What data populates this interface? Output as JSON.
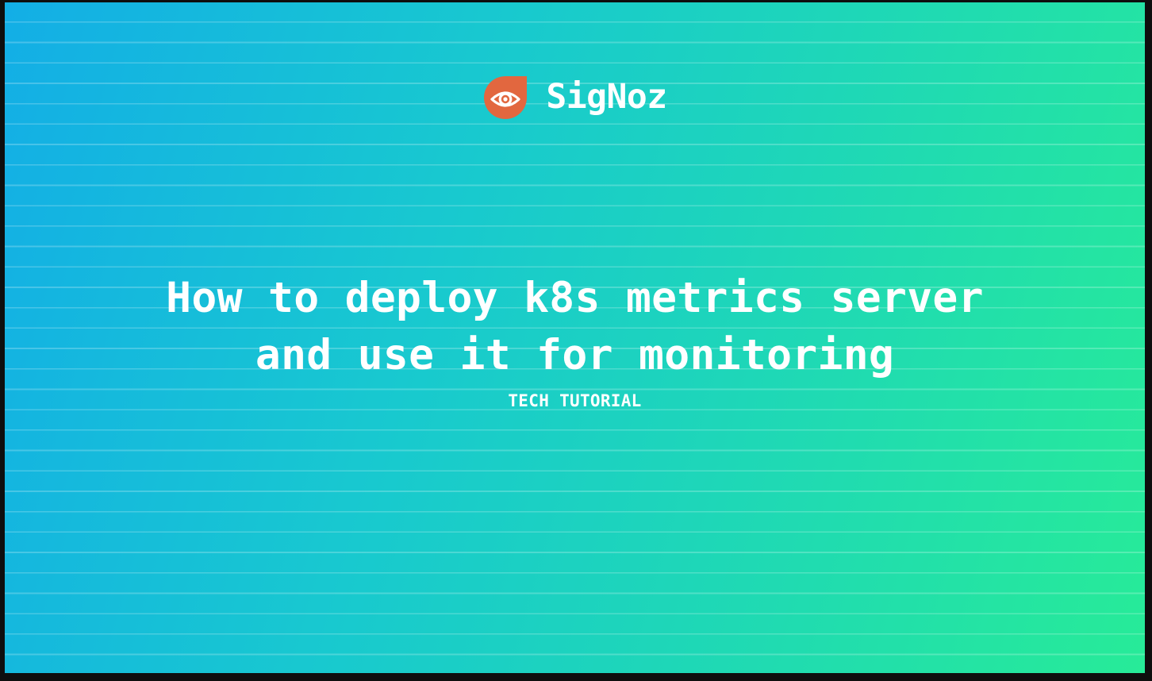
{
  "brand": {
    "name": "SigNoz",
    "icon": "eye-icon",
    "icon_color": "#e2673f"
  },
  "title": {
    "line1": "How to deploy k8s metrics server",
    "line2": "and use it for monitoring"
  },
  "category": "TECH TUTORIAL",
  "colors": {
    "gradient_start": "#13aee6",
    "gradient_end": "#27eb98",
    "text": "#ffffff"
  }
}
